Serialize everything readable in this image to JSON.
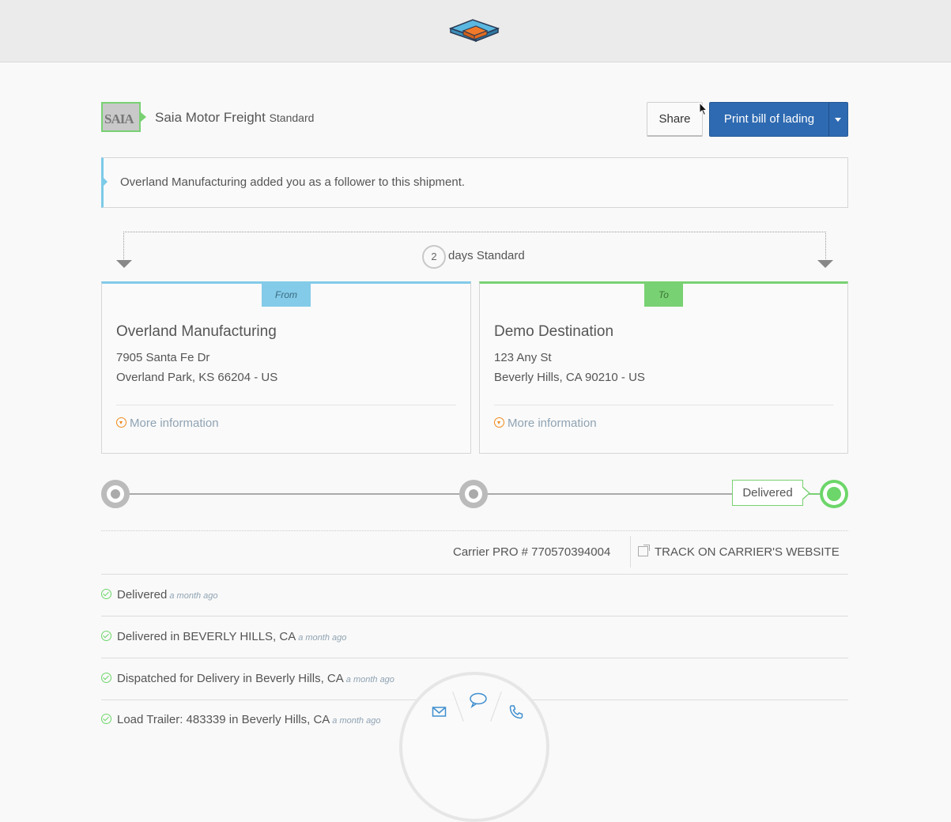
{
  "carrier": {
    "name": "Saia Motor Freight",
    "service": "Standard",
    "logo_text": "SAIA"
  },
  "actions": {
    "share_label": "Share",
    "print_label": "Print bill of lading"
  },
  "notice": {
    "message": "Overland Manufacturing added you as a follower to this shipment."
  },
  "transit": {
    "days": "2",
    "label": "days Standard"
  },
  "from": {
    "tag": "From",
    "name": "Overland Manufacturing",
    "address_line1": "7905 Santa Fe Dr",
    "address_line2": "Overland Park, KS 66204 - US",
    "more_label": "More information"
  },
  "to": {
    "tag": "To",
    "name": "Demo Destination",
    "address_line1": "123 Any St",
    "address_line2": "Beverly Hills, CA 90210 - US",
    "more_label": "More information"
  },
  "progress": {
    "status_label": "Delivered",
    "steps": 3,
    "current_step": 3
  },
  "tracking": {
    "pro_label": "Carrier PRO # 770570394004",
    "track_link": "TRACK ON CARRIER'S WEBSITE"
  },
  "events": [
    {
      "text": "Delivered",
      "ago": "a month ago"
    },
    {
      "text": "Delivered in BEVERLY HILLS, CA",
      "ago": "a month ago"
    },
    {
      "text": "Dispatched for Delivery in Beverly Hills, CA",
      "ago": "a month ago"
    },
    {
      "text": "Load Trailer: 483339 in Beverly Hills, CA",
      "ago": "a month ago"
    }
  ],
  "colors": {
    "primary": "#2e6ab1",
    "from_accent": "#83cbe9",
    "to_accent": "#78d172",
    "orange": "#f08a1c"
  },
  "contact_icons": [
    "mail-icon",
    "chat-icon",
    "phone-icon"
  ]
}
